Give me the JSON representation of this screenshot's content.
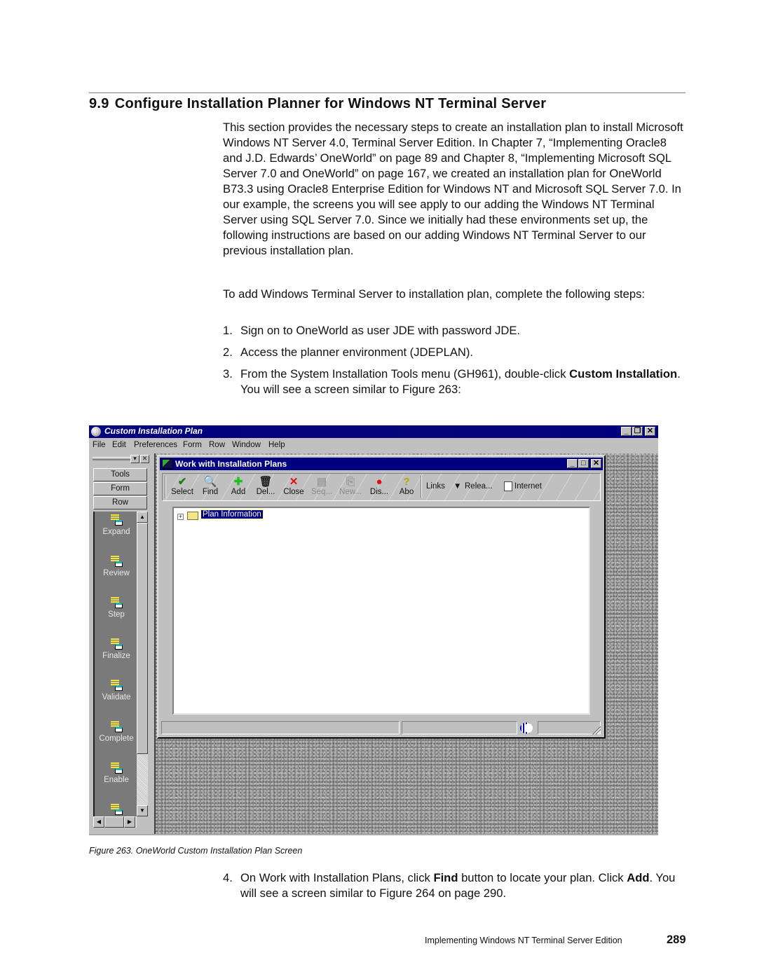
{
  "section": {
    "number": "9.9",
    "title": "Configure Installation Planner for Windows NT Terminal Server"
  },
  "intro": "This section provides the necessary steps to create an installation plan to install Microsoft Windows NT Server 4.0, Terminal Server Edition. In Chapter 7, “Implementing Oracle8 and J.D. Edwards’ OneWorld” on page 89 and Chapter 8, “Implementing Microsoft SQL Server 7.0 and OneWorld” on page 167, we created an installation plan for OneWorld B73.3 using Oracle8 Enterprise Edition for Windows NT and Microsoft SQL Server 7.0. In our example, the screens you will see apply to our adding the Windows NT Terminal Server using SQL Server 7.0. Since we initially had these environments set up, the following instructions are based on our adding Windows NT Terminal Server to our previous installation plan.",
  "lead": "To add Windows Terminal Server to installation plan, complete the following steps:",
  "steps": [
    {
      "n": "1.",
      "text": "Sign on to OneWorld as user JDE with password JDE."
    },
    {
      "n": "2.",
      "text": "Access the planner environment (JDEPLAN)."
    },
    {
      "n": "3.",
      "pre": "From the System Installation Tools menu (GH961), double-click ",
      "bold1": "Custom Installation",
      "post": ". You will see a screen similar to Figure 263:"
    },
    {
      "n": "4.",
      "pre": "On Work with Installation Plans, click ",
      "bold1": "Find",
      "mid": " button to locate your plan. Click ",
      "bold2": "Add",
      "post": ". You will see a screen similar to Figure 264 on page 290."
    }
  ],
  "screenshot": {
    "app_title": "Custom Installation Plan",
    "window_buttons": {
      "minimize": "_",
      "restore": "❐",
      "close": "✕"
    },
    "menu": [
      "File",
      "Edit",
      "Preferences",
      "Form",
      "Row",
      "Window",
      "Help"
    ],
    "palette": {
      "tabs": [
        "Tools",
        "Form",
        "Row"
      ],
      "items": [
        "Expand",
        "Review",
        "Step",
        "Finalize",
        "Validate",
        "Complete",
        "Enable"
      ]
    },
    "inner_window": {
      "title": "Work with Installation Plans",
      "toolbar": [
        {
          "label": "Select",
          "icon": "✔",
          "color": "#108010",
          "enabled": true
        },
        {
          "label": "Find",
          "icon": "🔍",
          "color": "#000000",
          "enabled": true
        },
        {
          "label": "Add",
          "icon": "✚",
          "color": "#20c020",
          "enabled": true
        },
        {
          "label": "Del...",
          "icon": "🗑",
          "color": "#202020",
          "enabled": true
        },
        {
          "label": "Close",
          "icon": "✕",
          "color": "#e01010",
          "enabled": true
        },
        {
          "label": "Seq...",
          "icon": "▤",
          "color": "#9a9a9a",
          "enabled": false
        },
        {
          "label": "New...",
          "icon": "⎘",
          "color": "#9a9a9a",
          "enabled": false
        },
        {
          "label": "Dis...",
          "icon": "●",
          "color": "#e01010",
          "enabled": true
        },
        {
          "label": "Abo",
          "icon": "?",
          "color": "#c0a000",
          "enabled": true
        }
      ],
      "links_label": "Links",
      "release_label": "Relea...",
      "internet_label": "Internet",
      "tree_node": "Plan Information"
    }
  },
  "caption": "Figure 263.  OneWorld Custom Installation Plan Screen",
  "footer": {
    "text": "Implementing Windows NT Terminal Server Edition",
    "page": "289"
  }
}
